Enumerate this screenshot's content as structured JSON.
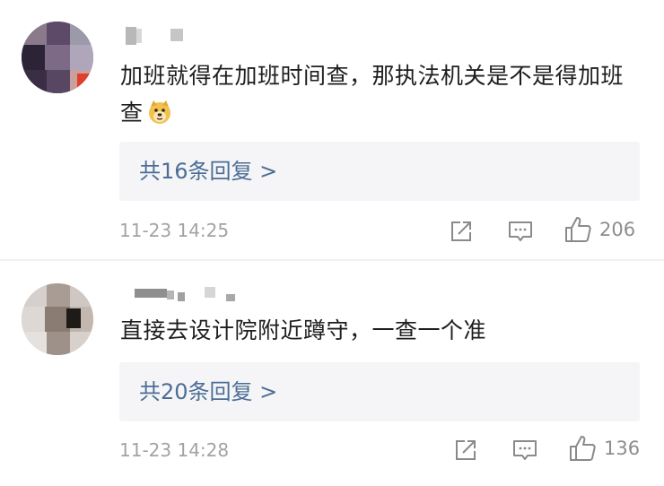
{
  "comments": [
    {
      "text": "加班就得在加班时间查，那执法机关是不是得加班查",
      "emoji": "doge-icon",
      "replies_label": "共16条回复 >",
      "time": "11-23 14:25",
      "likes": "206"
    },
    {
      "text": "直接去设计院附近蹲守，一查一个准",
      "replies_label": "共20条回复 >",
      "time": "11-23 14:28",
      "likes": "136"
    }
  ],
  "colors": {
    "link": "#4c6d96",
    "meta": "#a3a3a3",
    "reply_bg": "#f5f5f7"
  }
}
